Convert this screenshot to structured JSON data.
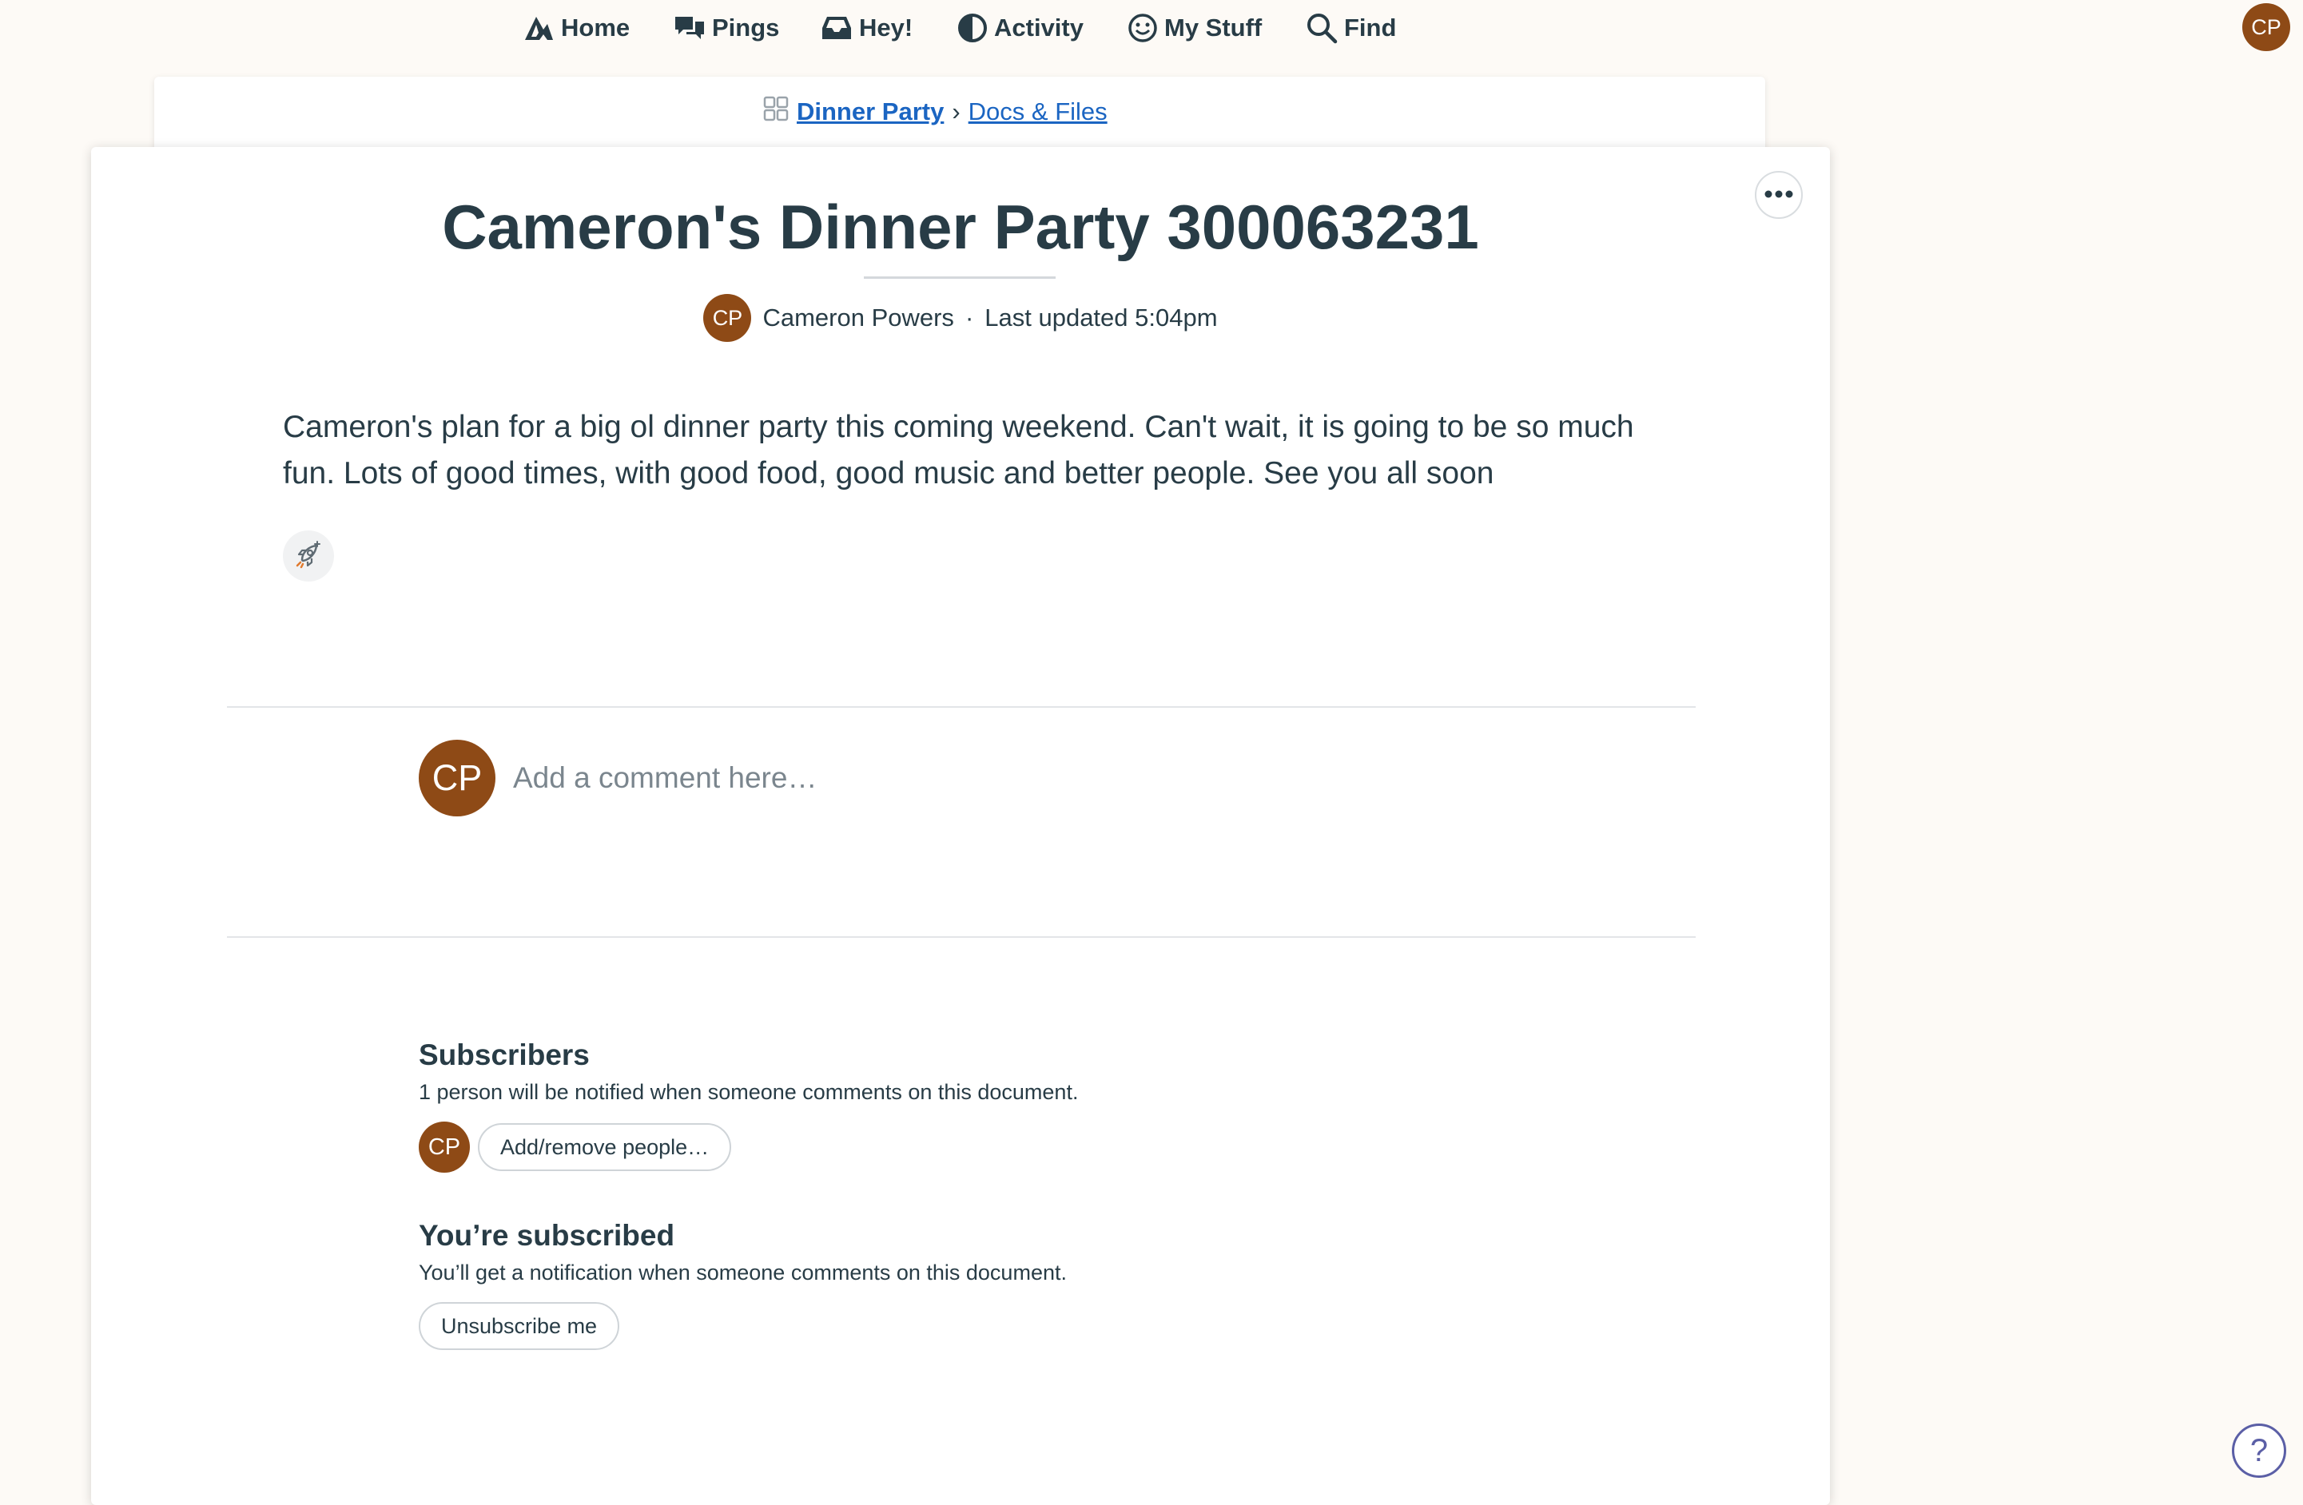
{
  "nav": {
    "items": [
      {
        "label": "Home",
        "icon": "home-icon"
      },
      {
        "label": "Pings",
        "icon": "pings-icon"
      },
      {
        "label": "Hey!",
        "icon": "hey-inbox-icon"
      },
      {
        "label": "Activity",
        "icon": "activity-icon"
      },
      {
        "label": "My Stuff",
        "icon": "smiley-icon"
      },
      {
        "label": "Find",
        "icon": "search-icon"
      }
    ],
    "avatar_initials": "CP"
  },
  "breadcrumb": {
    "project": "Dinner Party",
    "separator": "›",
    "tool": "Docs & Files"
  },
  "document": {
    "title": "Cameron's Dinner Party 300063231",
    "author_initials": "CP",
    "author": "Cameron Powers",
    "byline_separator": "·",
    "updated": "Last updated 5:04pm",
    "body": "Cameron's plan for a big ol dinner party this coming weekend. Can't wait, it is going to be so much fun. Lots of good times, with good food, good music and better people. See you all soon"
  },
  "comment": {
    "avatar_initials": "CP",
    "placeholder": "Add a comment here…"
  },
  "subscribers": {
    "heading": "Subscribers",
    "note": "1 person will be notified when someone comments on this document.",
    "avatar_initials": "CP",
    "button": "Add/remove people…"
  },
  "subscription": {
    "heading": "You’re subscribed",
    "note": "You’ll get a notification when someone comments on this document.",
    "button": "Unsubscribe me"
  },
  "help": {
    "label": "?"
  },
  "colors": {
    "background": "#fdfaf6",
    "text": "#283c46",
    "link": "#1b65c2",
    "avatar": "#8e4a16",
    "help": "#5b5fa6"
  }
}
